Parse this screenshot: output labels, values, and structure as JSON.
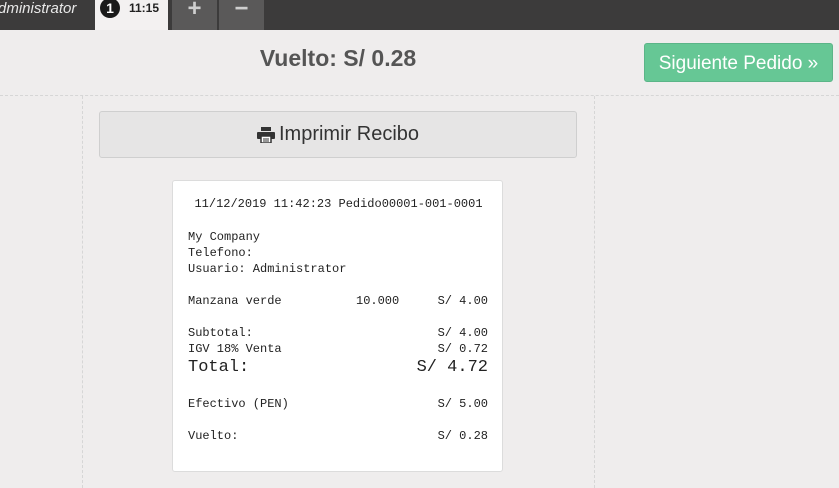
{
  "topbar": {
    "user_name": "Administrator",
    "order_number": "1",
    "order_time": "11:15",
    "add_label": "+",
    "remove_label": "−"
  },
  "header": {
    "change_title": "Vuelto: S/ 0.28",
    "next_order_label": "Siguiente Pedido »",
    "next_order_color": "#66c795"
  },
  "print_button": {
    "icon": "printer-icon",
    "label": "Imprimir Recibo"
  },
  "receipt": {
    "header": "11/12/2019 11:42:23 Pedido00001-001-0001",
    "company": "My Company",
    "phone_label": "Telefono:",
    "user_label": "Usuario: Administrator",
    "items": [
      {
        "name": "Manzana verde",
        "qty": "10.000",
        "price": "S/ 4.00"
      }
    ],
    "subtotal_label": "Subtotal:",
    "subtotal_value": "S/ 4.00",
    "tax_label": "IGV 18% Venta",
    "tax_value": "S/ 0.72",
    "total_label": "Total:",
    "total_value": "S/ 4.72",
    "payment_label": "Efectivo (PEN)",
    "payment_value": "S/ 5.00",
    "change_label": "Vuelto:",
    "change_value": "S/ 0.28"
  }
}
